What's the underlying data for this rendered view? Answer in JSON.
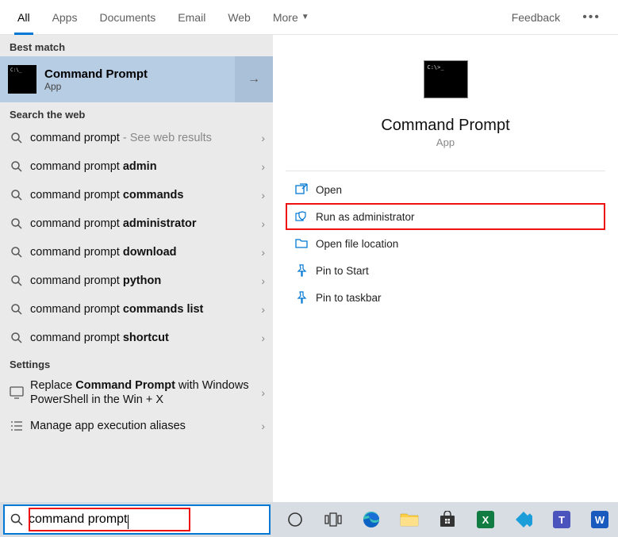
{
  "tabs": [
    "All",
    "Apps",
    "Documents",
    "Email",
    "Web",
    "More"
  ],
  "tabs_active_index": 0,
  "feedback_label": "Feedback",
  "sections": {
    "best_match_label": "Best match",
    "search_web_label": "Search the web",
    "settings_label": "Settings"
  },
  "best_match": {
    "title": "Command Prompt",
    "subtitle": "App"
  },
  "web_results": [
    {
      "prefix": "command prompt",
      "bold": "",
      "hint": " - See web results"
    },
    {
      "prefix": "command prompt ",
      "bold": "admin",
      "hint": ""
    },
    {
      "prefix": "command prompt ",
      "bold": "commands",
      "hint": ""
    },
    {
      "prefix": "command prompt ",
      "bold": "administrator",
      "hint": ""
    },
    {
      "prefix": "command prompt ",
      "bold": "download",
      "hint": ""
    },
    {
      "prefix": "command prompt ",
      "bold": "python",
      "hint": ""
    },
    {
      "prefix": "command prompt ",
      "bold": "commands list",
      "hint": ""
    },
    {
      "prefix": "command prompt ",
      "bold": "shortcut",
      "hint": ""
    }
  ],
  "settings_results": [
    {
      "html": "Replace <b>Command Prompt</b> with Windows PowerShell in the Win + X",
      "icon": "monitor"
    },
    {
      "html": "Manage app execution aliases",
      "icon": "list"
    }
  ],
  "detail": {
    "title": "Command Prompt",
    "subtitle": "App",
    "actions": [
      {
        "icon": "open",
        "label": "Open",
        "highlight": false
      },
      {
        "icon": "shield",
        "label": "Run as administrator",
        "highlight": true
      },
      {
        "icon": "folder",
        "label": "Open file location",
        "highlight": false
      },
      {
        "icon": "pin-start",
        "label": "Pin to Start",
        "highlight": false
      },
      {
        "icon": "pin-task",
        "label": "Pin to taskbar",
        "highlight": false
      }
    ]
  },
  "search_value": "command prompt",
  "taskbar_icons": [
    {
      "name": "cortana",
      "glyph": "circle"
    },
    {
      "name": "task-view",
      "glyph": "taskview"
    },
    {
      "name": "edge",
      "glyph": "edge"
    },
    {
      "name": "file-explorer",
      "glyph": "folder"
    },
    {
      "name": "store",
      "glyph": "store"
    },
    {
      "name": "excel",
      "glyph": "X",
      "bg": "#107c41"
    },
    {
      "name": "kodi",
      "glyph": "kodi",
      "bg": "#1b9dd9"
    },
    {
      "name": "teams",
      "glyph": "T",
      "bg": "#4b53bc"
    },
    {
      "name": "word",
      "glyph": "W",
      "bg": "#185abd"
    }
  ]
}
